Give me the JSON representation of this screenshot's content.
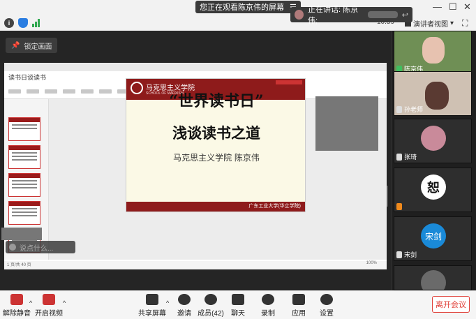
{
  "top": {
    "viewing_text": "您正在观看陈京伟的屏幕",
    "speaking_text": "正在讲话: 陈京伟;",
    "clock": "10:59",
    "view_mode": "演讲者视图"
  },
  "share": {
    "lock_view": "锁定画面",
    "ppt_title": "读书日谈读书",
    "slide_school": "马克思主义学院",
    "slide_school_en": "SCHOOL OF MARXISM",
    "slide_title1": "“世界读书日”",
    "slide_title2": "浅谈读书之道",
    "slide_author": "马克思主义学院    陈京伟",
    "slide_footer": "广东工业大学(华立学院)",
    "status_left": "1 页/共 40 页",
    "zoom": "100%",
    "chat_placeholder": "说点什么..."
  },
  "participants": [
    {
      "name": "陈京伟",
      "mic": "on",
      "color": "#7a9a5a"
    },
    {
      "name": "孙老师",
      "mic": "off",
      "color": "#c9b9a8"
    },
    {
      "name": "张琦",
      "mic": "off",
      "color": "#c98a9a"
    },
    {
      "name": "",
      "mic": "off",
      "color": "#ffffff"
    },
    {
      "name": "宋剑",
      "mic": "off",
      "color": "#1a8ad8",
      "avatar_text": "宋剑"
    },
    {
      "name": "",
      "mic": "off",
      "color": "#6a6a6a"
    }
  ],
  "toolbar": {
    "unmute": "解除静音",
    "start_video": "开启视频",
    "share_screen": "共享屏幕",
    "invite": "邀请",
    "members": "成员(42)",
    "chat": "聊天",
    "record": "录制",
    "apps": "应用",
    "settings": "设置",
    "leave": "离开会议"
  }
}
